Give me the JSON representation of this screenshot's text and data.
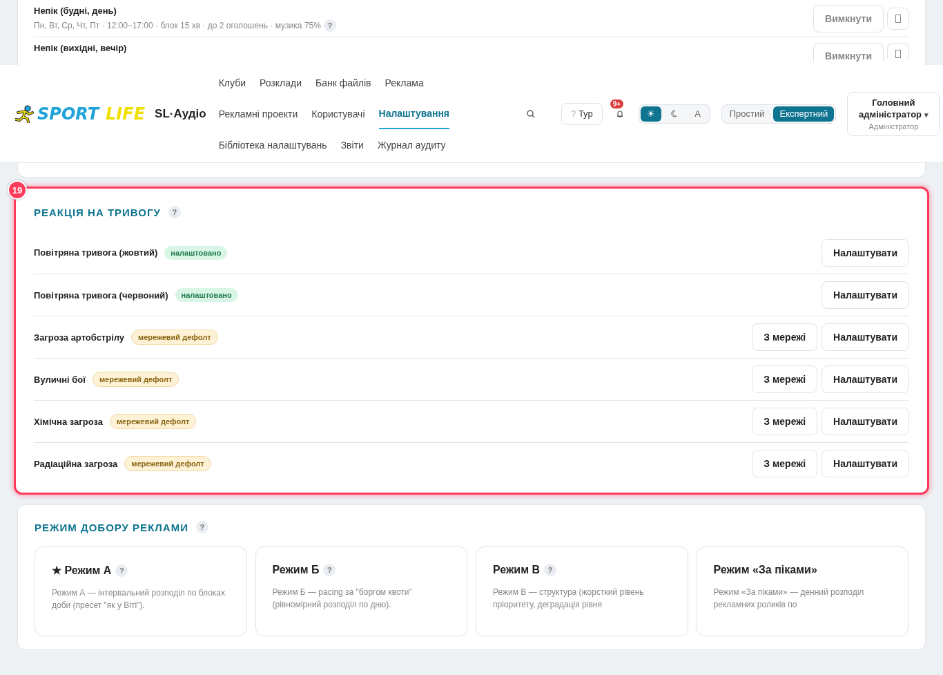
{
  "schedule_rows": [
    {
      "title": "Непік (будні, день)",
      "subtitle": "Пн, Вт, Ср, Чт, Пт · 12:00–17:00 · блок 15 хв · до 2 оголошень · музика 75%",
      "help": "?",
      "button": "Вимкнути"
    },
    {
      "title": "Непік (вихідні, вечір)",
      "button": "Вимкнути"
    }
  ],
  "header": {
    "logo": {
      "word_1": "SPORT",
      "word_2": "LIFE"
    },
    "app_name": "SL·Аудіо",
    "nav": [
      [
        {
          "label": "Клуби",
          "selected": false
        },
        {
          "label": "Розклади",
          "selected": false
        },
        {
          "label": "Банк файлів",
          "selected": false
        },
        {
          "label": "Реклама",
          "selected": false
        }
      ],
      [
        {
          "label": "Рекламні проекти",
          "selected": false
        },
        {
          "label": "Користувачі",
          "selected": false
        },
        {
          "label": "Налаштування",
          "selected": true
        }
      ],
      [
        {
          "label": "Бібліотека налаштувань",
          "selected": false
        },
        {
          "label": "Звіти",
          "selected": false
        },
        {
          "label": "Журнал аудиту",
          "selected": false
        }
      ]
    ],
    "tour_button": {
      "icon": "?",
      "label": "Тур"
    },
    "notifications": {
      "count": "9+"
    },
    "theme": [
      {
        "kind": "sun",
        "label": "☀",
        "selected": true
      },
      {
        "kind": "moon",
        "selected": false
      },
      {
        "kind": "auto",
        "label": "A",
        "selected": false
      }
    ],
    "modes": [
      {
        "label": "Простий",
        "selected": false
      },
      {
        "label": "Експертний",
        "selected": true
      }
    ],
    "user": {
      "name": "Головний адміністратор",
      "caret": "▾",
      "role": "Адміністратор"
    }
  },
  "alarm_section": {
    "marker": "19",
    "title": "РЕАКЦІЯ НА ТРИВОГУ",
    "help": "?",
    "rows": [
      {
        "name": "Повітряна тривога (жовтий)",
        "kind": "configured",
        "badge": "налаштовано",
        "buttons": [
          "Налаштувати"
        ]
      },
      {
        "name": "Повітряна тривога (червоний)",
        "kind": "configured",
        "badge": "налаштовано",
        "buttons": [
          "Налаштувати"
        ]
      },
      {
        "name": "Загроза артобстрілу",
        "kind": "default",
        "badge": "мережевий дефолт",
        "buttons": [
          "З мережі",
          "Налаштувати"
        ]
      },
      {
        "name": "Вуличні бої",
        "kind": "default",
        "badge": "мережевий дефолт",
        "buttons": [
          "З мережі",
          "Налаштувати"
        ]
      },
      {
        "name": "Хімічна загроза",
        "kind": "default",
        "badge": "мережевий дефолт",
        "buttons": [
          "З мережі",
          "Налаштувати"
        ]
      },
      {
        "name": "Радіаційна загроза",
        "kind": "default",
        "badge": "мережевий дефолт",
        "buttons": [
          "З мережі",
          "Налаштувати"
        ]
      }
    ]
  },
  "ad_mode_section": {
    "title": "РЕЖИМ ДОБОРУ РЕКЛАМИ",
    "help": "?",
    "modes": [
      {
        "title": "★ Режим А",
        "help": "?",
        "description": "Режим А — інтервальний розподіл по блоках доби (пресет \"як у Віті\")."
      },
      {
        "title": "Режим Б",
        "help": "?",
        "description": "Режим Б — pacing за \"боргом квоти\" (рівномірний розподіл по дню)."
      },
      {
        "title": "Режим В",
        "help": "?",
        "description": "Режим В — структура (жорсткий рівень пріоритету, деградація рівня"
      },
      {
        "title": "Режим «За піками»",
        "description": "Режим «За піками» — денний розподіл рекламних роликів по"
      }
    ]
  }
}
